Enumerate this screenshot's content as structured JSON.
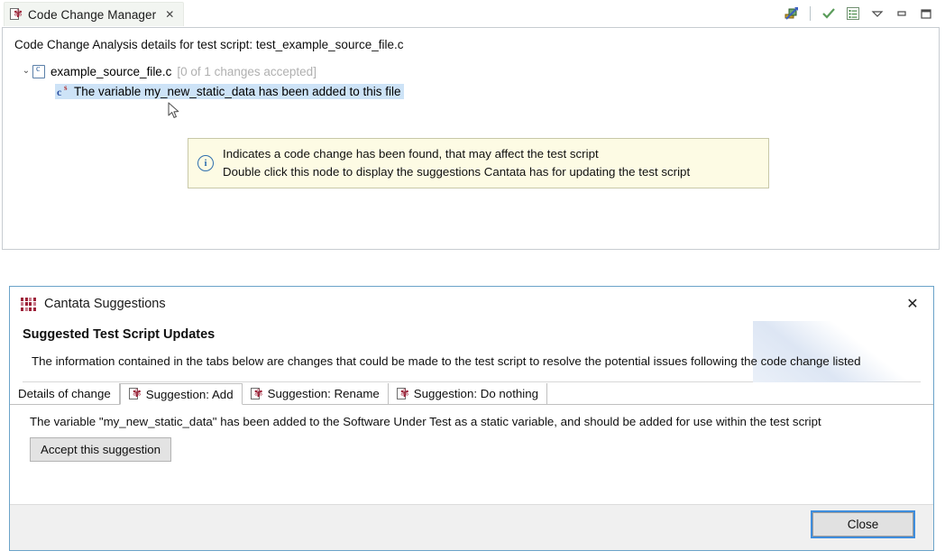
{
  "view": {
    "tab_label": "Code Change Manager",
    "tab_close_glyph": "✕",
    "analysis_line": "Code Change Analysis details for test script: test_example_source_file.c",
    "toolbar": {
      "link_with_editor": "link-with-editor",
      "check_label": "✓",
      "list_label": "list",
      "menu_label": "▽",
      "minimize_label": "▭",
      "maximize_label": "❐"
    },
    "tree": {
      "root": {
        "twisty": "⌄",
        "label": "example_source_file.c",
        "status": "[0 of 1 changes accepted]"
      },
      "child": {
        "label": "The variable my_new_static_data has been added to this file"
      }
    }
  },
  "tooltip": {
    "icon": "info-icon",
    "line1": "Indicates a code change has been found, that may affect the test script",
    "line2": "Double click this node to display the suggestions Cantata has for updating the test script"
  },
  "dialog": {
    "title": "Cantata Suggestions",
    "close_glyph": "✕",
    "heading": "Suggested Test Script Updates",
    "description": "The information contained in the tabs below are changes that could be made to the test script to resolve the potential issues following the code change listed",
    "tabs": [
      {
        "label": "Details of change",
        "has_icon": false,
        "selected": false
      },
      {
        "label": "Suggestion: Add",
        "has_icon": true,
        "selected": true
      },
      {
        "label": "Suggestion: Rename",
        "has_icon": true,
        "selected": false
      },
      {
        "label": "Suggestion: Do nothing",
        "has_icon": true,
        "selected": false
      }
    ],
    "content_text": "The variable \"my_new_static_data\" has been added to the Software Under Test as a static variable, and should be added for use within the test script",
    "accept_button": "Accept this suggestion",
    "close_button": "Close"
  },
  "colors": {
    "selection_blue": "#cde3f7",
    "tooltip_yellow": "#fdfbe4",
    "cantata_red": "#9d2138",
    "focus_blue": "#3e8ddd",
    "dialog_border": "#6ba3c9"
  }
}
